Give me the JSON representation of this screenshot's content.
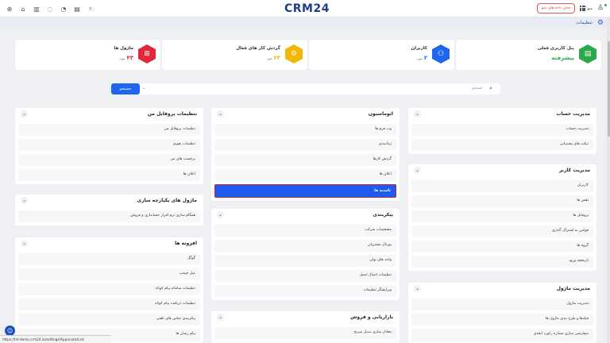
{
  "topbar": {
    "logo": "CRM24",
    "demo_button": "حذف داده های دمو",
    "grid_label": "منو",
    "icons": [
      "plus-circle-icon",
      "home-icon",
      "chart-icon",
      "chat-icon",
      "bell-icon",
      "calendar-icon",
      "search-icon"
    ]
  },
  "page": {
    "title": "تنظیمات"
  },
  "cards": [
    {
      "label": "پنل کاربری فعلی",
      "value": "پیشرفته",
      "unit": "",
      "color": "#2aa84a",
      "icon": "document-icon",
      "value_color": "#2aa84a"
    },
    {
      "label": "کاربران",
      "value": "۲",
      "unit": "مورد",
      "color": "#1d67f0",
      "icon": "users-icon",
      "value_color": "#1d67f0"
    },
    {
      "label": "گردش کار های فعال",
      "value": "۲۳",
      "unit": "مورد",
      "color": "#f2b705",
      "icon": "workflow-icon",
      "value_color": "#f2b705"
    },
    {
      "label": "ماژول ها",
      "value": "۴۳",
      "unit": "مورد",
      "color": "#e0283a",
      "icon": "modules-icon",
      "value_color": "#e0283a"
    }
  ],
  "search": {
    "placeholder": "جستجو",
    "button": "جستجو"
  },
  "panels": {
    "account": {
      "title": "مدیریت حساب",
      "items": [
        "مدیریت حساب",
        "تیکت های پشتیبانی"
      ]
    },
    "users": {
      "title": "مدیریت کاربر",
      "items": [
        "کاربران",
        "نقش ها",
        "پروفایل ها",
        "قوانین به اشتراک گذاری",
        "گروه ها",
        "تاریخچه ورود"
      ]
    },
    "modules": {
      "title": "مدیریت ماژول",
      "items": [
        "مدیریت ماژول",
        "فیلدها و طرح بندی ماژول ها",
        "سفارشی سازی شماره رکورد ابجدی"
      ]
    },
    "automation": {
      "title": "اتوماسیون",
      "items": [
        "وب فرم ها",
        "زمانبندی",
        "گردش کارها",
        "اعلان ها",
        "تائیدیه ها"
      ],
      "active_index": 4
    },
    "config": {
      "title": "پیکربندی",
      "items": [
        "مشخصات شرکت",
        "پورتال مشتریان",
        "واحد های پولی",
        "تنظیمات اتصال ایمیل",
        "ویرایشگر تنظیمات"
      ]
    },
    "marketing": {
      "title": "بازاریابی و فروش",
      "items": [
        "معادل سازی تبدیل سرنخ"
      ]
    },
    "profile": {
      "title": "تنظیمات پروفایل من",
      "items": [
        "تنظیمات پروفایل من",
        "تنظیمات تقویم",
        "برچسب های من",
        "اعلان ها"
      ]
    },
    "integration": {
      "title": "ماژول های یکپارچه سازی",
      "items": [
        "همگام سازی نرم افزار حسابداری و فروش"
      ]
    },
    "addons": {
      "title": "افزونه ها",
      "items": [
        "گوگل",
        "میل چیمپ",
        "تنظیمات سامانه پیام کوتاه",
        "تنظیمات دریافت پیام کوتاه",
        "پیکربندی تماس های تلفنی",
        "پیام رسان ها"
      ]
    }
  },
  "statusbar": {
    "url": "https://tst-demo.crm24.io/settings/Approvals/List"
  }
}
